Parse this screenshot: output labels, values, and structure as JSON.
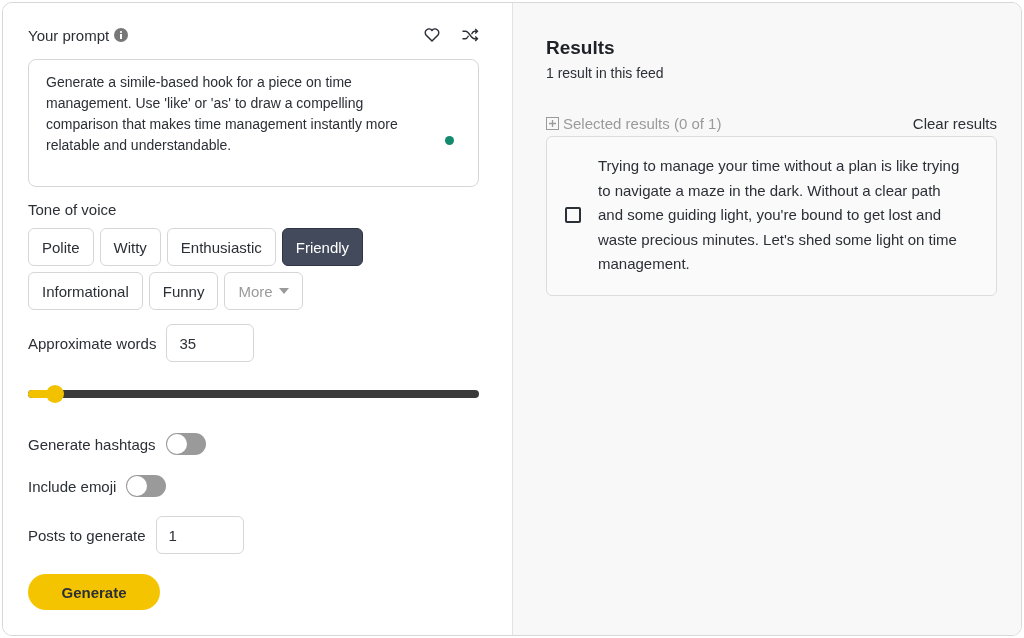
{
  "prompt": {
    "label": "Your prompt",
    "text": "Generate a simile-based hook for a piece on time management. Use 'like' or 'as' to draw a compelling comparison that makes time management instantly more relatable and understandable."
  },
  "tone": {
    "label": "Tone of voice",
    "options": [
      {
        "label": "Polite",
        "selected": false
      },
      {
        "label": "Witty",
        "selected": false
      },
      {
        "label": "Enthusiastic",
        "selected": false
      },
      {
        "label": "Friendly",
        "selected": true
      },
      {
        "label": "Informational",
        "selected": false
      },
      {
        "label": "Funny",
        "selected": false
      }
    ],
    "more": "More"
  },
  "words": {
    "label": "Approximate words",
    "value": "35",
    "level": 0.06
  },
  "toggles": [
    {
      "label": "Generate hashtags",
      "on": false
    },
    {
      "label": "Include emoji",
      "on": false
    }
  ],
  "posts": {
    "label": "Posts to generate",
    "value": "1"
  },
  "generate": "Generate",
  "results": {
    "title": "Results",
    "subtitle": "1 result in this feed",
    "selected_label": "Selected results (0 of 1)",
    "clear": "Clear results",
    "items": [
      {
        "text": "Trying to manage your time without a plan is like trying to navigate a maze in the dark. Without a clear path and some guiding light, you're bound to get lost and waste precious minutes. Let's shed some light on time management.",
        "checked": false
      }
    ]
  }
}
